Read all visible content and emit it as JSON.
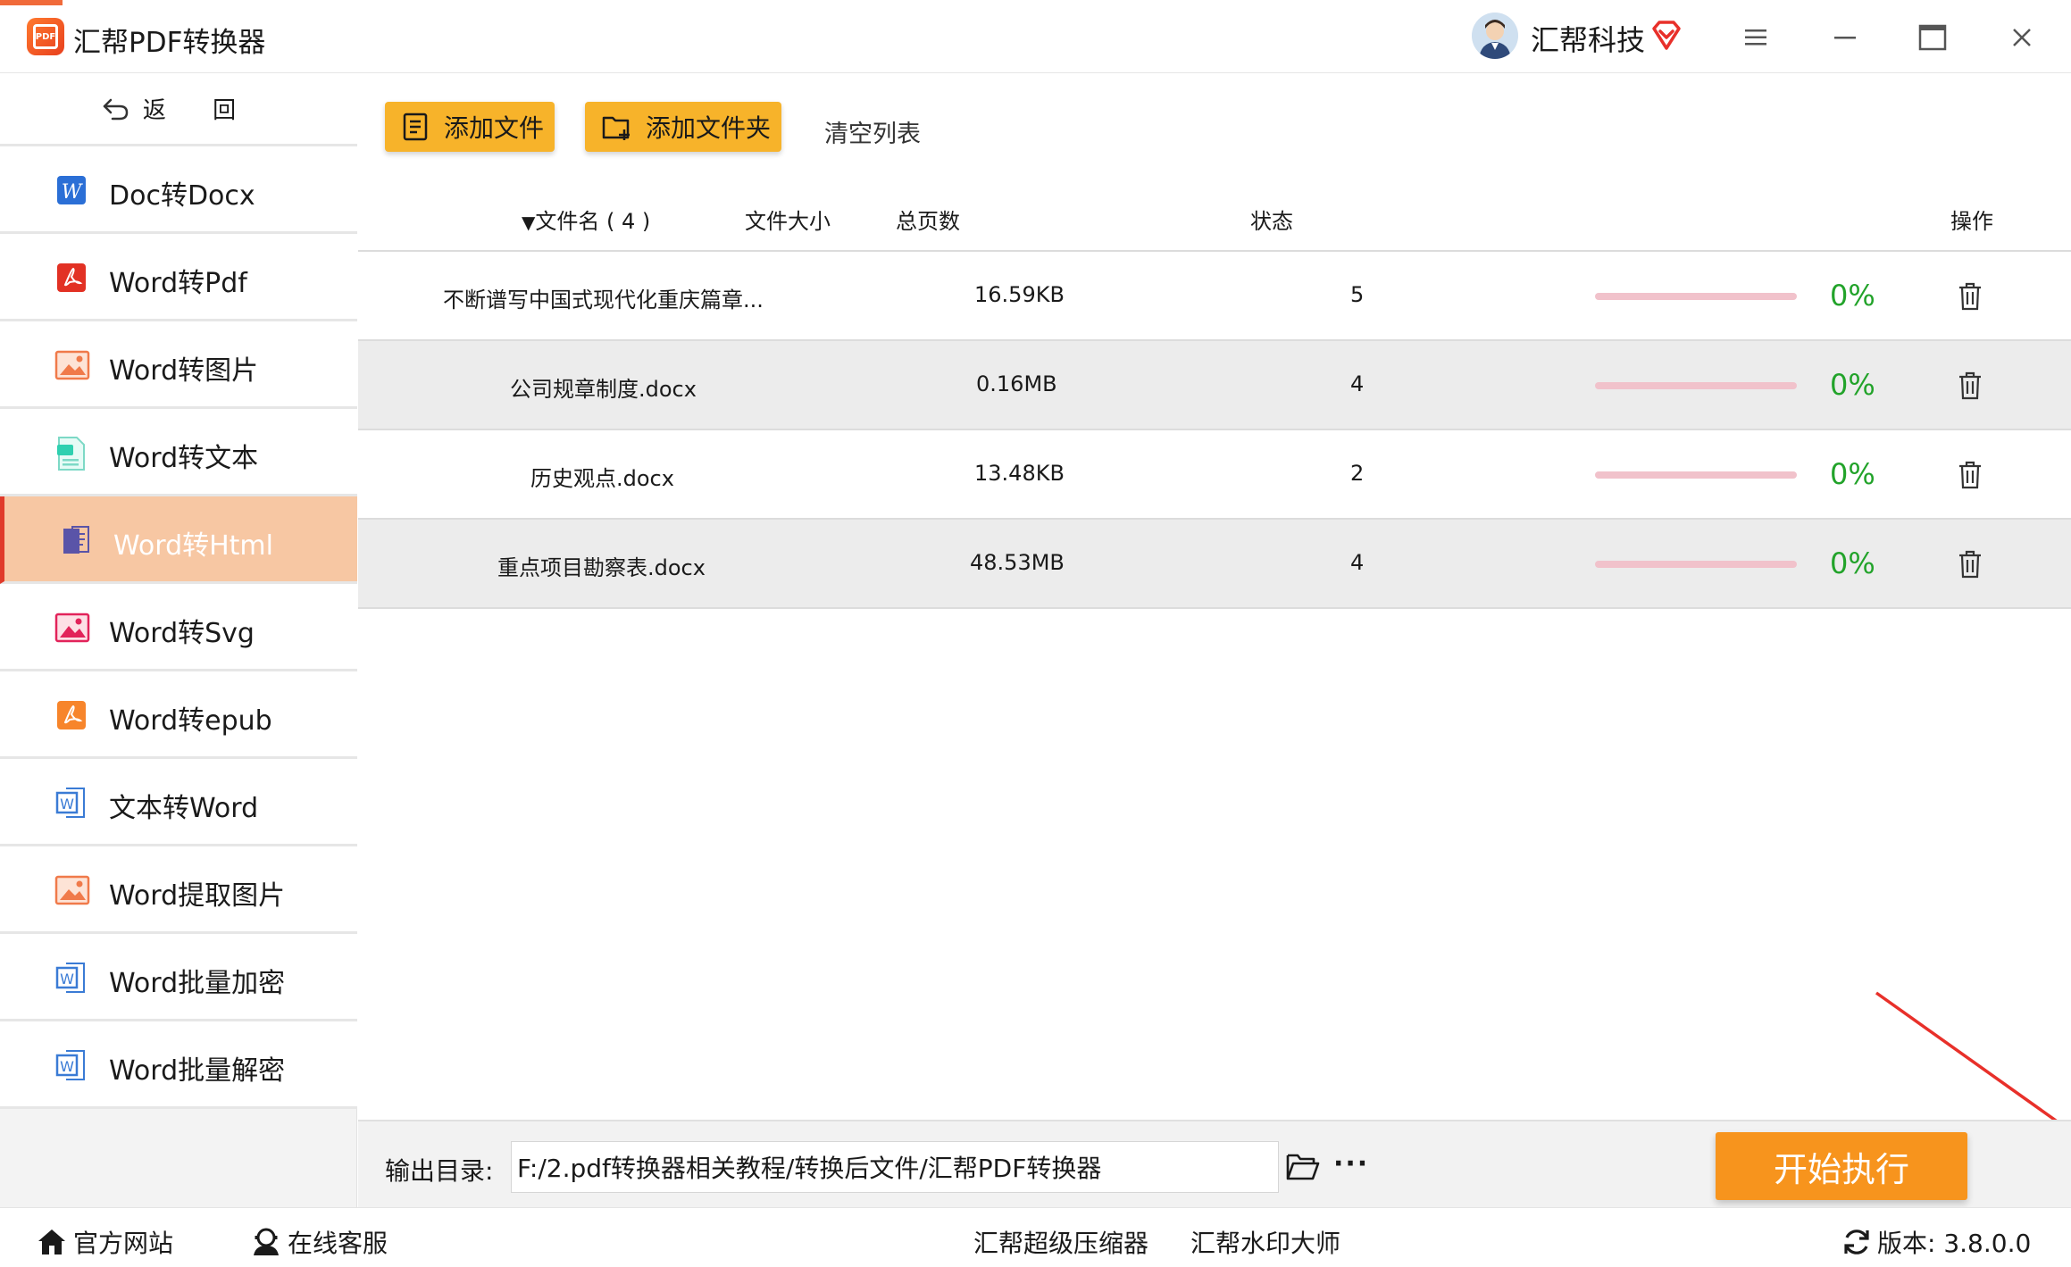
{
  "window": {
    "title": "汇帮PDF转换器",
    "logo_text": "PDF",
    "user_name": "汇帮科技"
  },
  "sidebar": {
    "back_label": "返 回",
    "items": [
      {
        "label": "Doc转Docx",
        "icon": "word-icon"
      },
      {
        "label": "Word转Pdf",
        "icon": "pdf-icon"
      },
      {
        "label": "Word转图片",
        "icon": "image-icon"
      },
      {
        "label": "Word转文本",
        "icon": "text-file-icon"
      },
      {
        "label": "Word转Html",
        "icon": "html-icon"
      },
      {
        "label": "Word转Svg",
        "icon": "svg-image-icon"
      },
      {
        "label": "Word转epub",
        "icon": "epub-icon"
      },
      {
        "label": "文本转Word",
        "icon": "word-doc-icon"
      },
      {
        "label": "Word提取图片",
        "icon": "image-icon"
      },
      {
        "label": "Word批量加密",
        "icon": "word-doc-icon"
      },
      {
        "label": "Word批量解密",
        "icon": "word-doc-icon"
      }
    ],
    "active_index": 4
  },
  "toolbar": {
    "add_file_label": "添加文件",
    "add_folder_label": "添加文件夹",
    "clear_label": "清空列表"
  },
  "table": {
    "headers": {
      "name": "文件名 ( 4 )",
      "size": "文件大小",
      "pages": "总页数",
      "status": "状态",
      "action": "操作"
    },
    "rows": [
      {
        "name": "不断谱写中国式现代化重庆篇章...",
        "size": "16.59KB",
        "pages": "5",
        "progress": 0,
        "percent": "0%"
      },
      {
        "name": "公司规章制度.docx",
        "size": "0.16MB",
        "pages": "4",
        "progress": 0,
        "percent": "0%"
      },
      {
        "name": "历史观点.docx",
        "size": "13.48KB",
        "pages": "2",
        "progress": 0,
        "percent": "0%"
      },
      {
        "name": "重点项目勘察表.docx",
        "size": "48.53MB",
        "pages": "4",
        "progress": 0,
        "percent": "0%"
      }
    ]
  },
  "output": {
    "label": "输出目录:",
    "path": "F:/2.pdf转换器相关教程/转换后文件/汇帮PDF转换器",
    "more": "···",
    "start_label": "开始执行"
  },
  "statusbar": {
    "website": "官方网站",
    "support": "在线客服",
    "compressor": "汇帮超级压缩器",
    "watermark": "汇帮水印大师",
    "version": "版本: 3.8.0.0"
  },
  "colors": {
    "accent": "#f7941d",
    "tool_button": "#f7b32a",
    "active_item": "#f7c7a3",
    "active_border": "#e03a2a",
    "percent_green": "#22a32a",
    "arrow_red": "#e8302a"
  }
}
